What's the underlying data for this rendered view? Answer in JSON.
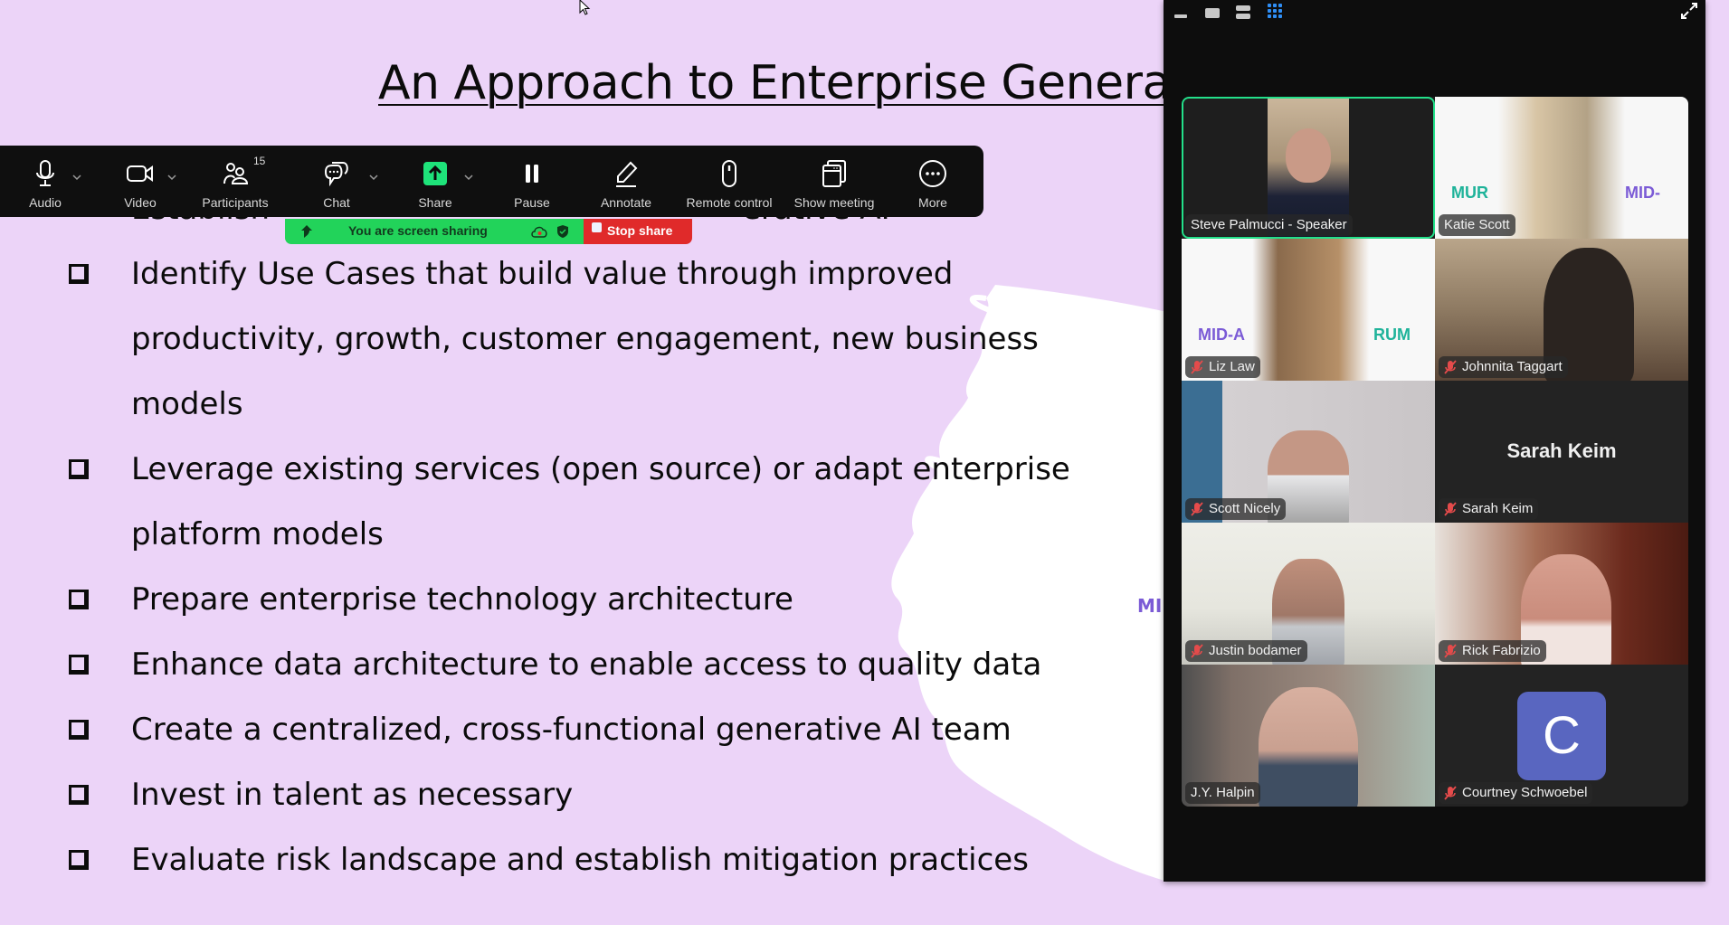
{
  "slide": {
    "title": "An Approach to Enterprise Generati",
    "hidden_bullet_left": "Establish",
    "hidden_bullet_right": "erative AI",
    "bullets": [
      {
        "lines": [
          "Identify Use Cases that build value through improved",
          "productivity, growth, customer engagement, new business",
          "models"
        ]
      },
      {
        "lines": [
          "Leverage existing services (open source) or adapt enterprise",
          "platform models"
        ]
      },
      {
        "lines": [
          "Prepare enterprise technology architecture"
        ]
      },
      {
        "lines": [
          "Enhance data architecture to enable access to quality data"
        ]
      },
      {
        "lines": [
          "Create a centralized, cross-functional generative AI team"
        ]
      },
      {
        "lines": [
          "Invest in talent as necessary"
        ]
      },
      {
        "lines": [
          "Evaluate risk landscape and establish mitigation practices"
        ]
      }
    ],
    "logo_fragment": "MI"
  },
  "toolbar": {
    "items": [
      {
        "label": "Audio",
        "icon": "microphone-icon",
        "has_caret": true
      },
      {
        "label": "Video",
        "icon": "video-camera-icon",
        "has_caret": true
      },
      {
        "label": "Participants",
        "icon": "participants-icon",
        "badge": "15"
      },
      {
        "label": "Chat",
        "icon": "chat-icon",
        "has_caret": true
      },
      {
        "label": "Share",
        "icon": "share-screen-icon",
        "has_caret": true
      },
      {
        "label": "Pause",
        "icon": "pause-icon"
      },
      {
        "label": "Annotate",
        "icon": "annotate-pencil-icon"
      },
      {
        "label": "Remote control",
        "icon": "mouse-icon"
      },
      {
        "label": "Show meeting",
        "icon": "window-icon"
      },
      {
        "label": "More",
        "icon": "more-ellipsis-icon"
      }
    ],
    "accent": "#1ee37a"
  },
  "sharebar": {
    "status": "You are screen sharing",
    "stop_label": "Stop share",
    "green": "#22d35a",
    "red": "#e02a2a"
  },
  "panel": {
    "view_modes": [
      "minimize",
      "speaker-view",
      "strip-view",
      "gallery-view"
    ],
    "active_view": "gallery-view",
    "tiles": [
      {
        "name": "Steve Palmucci - Speaker",
        "muted": false,
        "speaking": true
      },
      {
        "name": "Katie Scott",
        "muted": false
      },
      {
        "name": "Liz Law",
        "muted": true
      },
      {
        "name": "Johnnita Taggart",
        "muted": true
      },
      {
        "name": "Scott Nicely",
        "muted": true
      },
      {
        "name": "Sarah Keim",
        "muted": true,
        "video_off": true,
        "display": "Sarah Keim"
      },
      {
        "name": "Justin bodamer",
        "muted": true
      },
      {
        "name": "Rick Fabrizio",
        "muted": true
      },
      {
        "name": "J.Y. Halpin",
        "muted": false
      },
      {
        "name": "Courtney Schwoebel",
        "muted": true,
        "video_off": true,
        "avatar_letter": "C"
      }
    ]
  }
}
